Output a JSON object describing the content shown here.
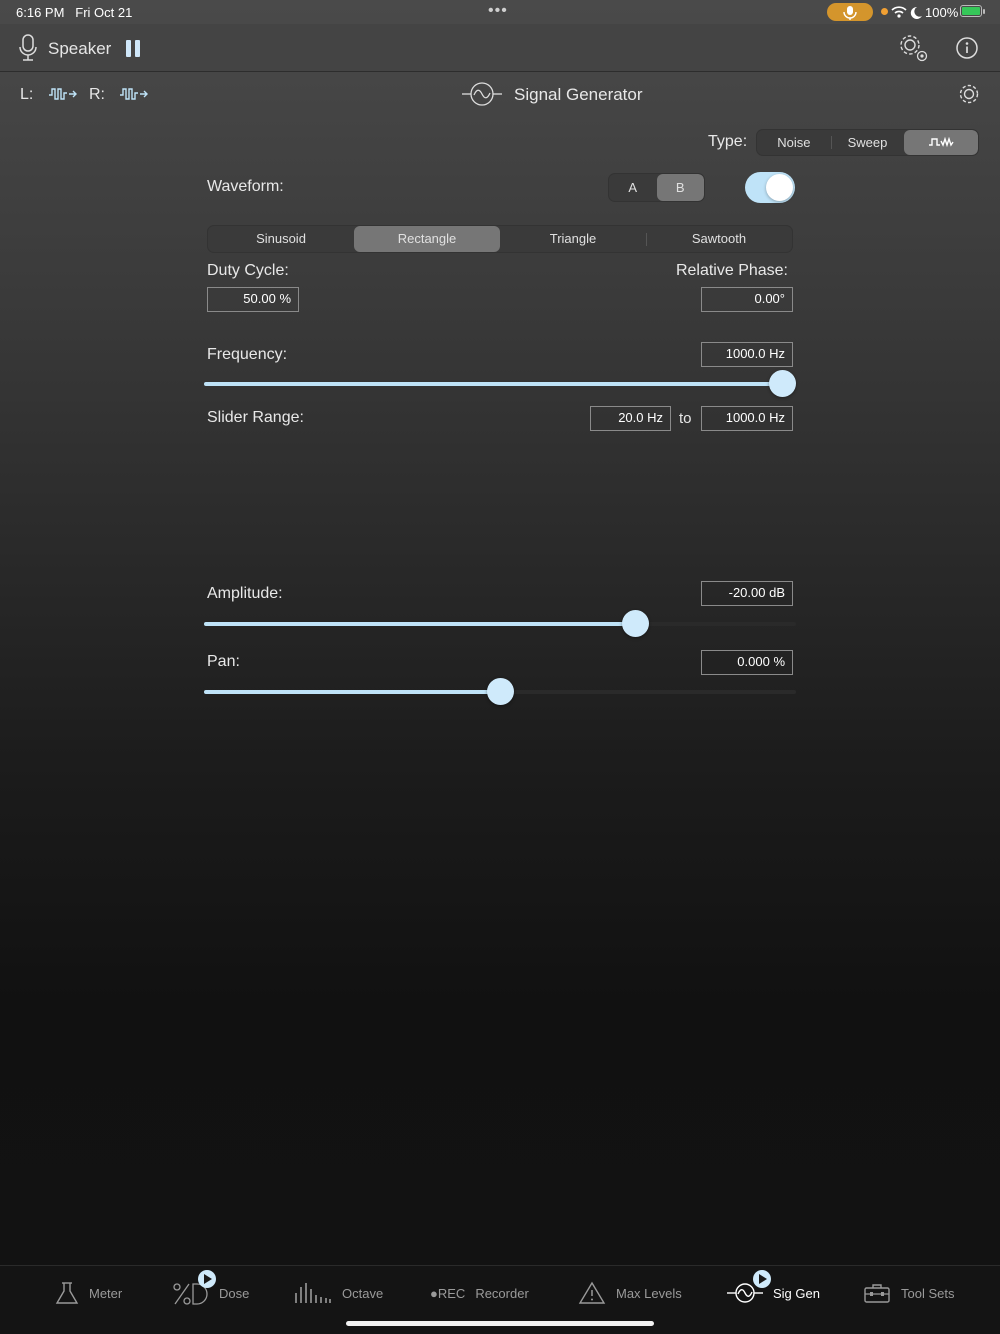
{
  "status_bar": {
    "time": "6:16 PM",
    "date": "Fri Oct 21",
    "battery": "100%",
    "colors": {
      "mic_pill": "#d4952c",
      "battery_fill": "#36c759"
    }
  },
  "toolbar": {
    "input_label": "Speaker"
  },
  "sub_header": {
    "left_channel": "L:",
    "right_channel": "R:",
    "title": "Signal Generator"
  },
  "type_selector": {
    "label": "Type:",
    "options": [
      "Noise",
      "Sweep",
      "waveform"
    ],
    "selected": 2
  },
  "waveform": {
    "label": "Waveform:",
    "ab_options": [
      "A",
      "B"
    ],
    "ab_selected": 1,
    "enabled": true,
    "shapes": [
      "Sinusoid",
      "Rectangle",
      "Triangle",
      "Sawtooth"
    ],
    "shape_selected": 1
  },
  "duty_cycle": {
    "label": "Duty Cycle:",
    "value": "50.00 %"
  },
  "relative_phase": {
    "label": "Relative Phase:",
    "value": "0.00°"
  },
  "frequency": {
    "label": "Frequency:",
    "value": "1000.0 Hz",
    "slider_fraction": 1.0
  },
  "slider_range": {
    "label": "Slider Range:",
    "min": "20.0 Hz",
    "to_label": "to",
    "max": "1000.0 Hz"
  },
  "amplitude": {
    "label": "Amplitude:",
    "value": "-20.00 dB",
    "slider_fraction": 0.74
  },
  "pan": {
    "label": "Pan:",
    "value": "0.000 %",
    "slider_fraction": 0.5
  },
  "tabs": [
    {
      "label": "Meter",
      "icon": "flask-icon"
    },
    {
      "label": "Dose",
      "icon": "percent-dose-icon"
    },
    {
      "label": "Octave",
      "icon": "bars-icon"
    },
    {
      "label": "Recorder",
      "icon": "rec-icon",
      "prefix": "●REC"
    },
    {
      "label": "Max Levels",
      "icon": "warning-icon"
    },
    {
      "label": "Sig Gen",
      "icon": "sine-wave-icon",
      "active": true
    },
    {
      "label": "Tool Sets",
      "icon": "toolbox-icon"
    }
  ],
  "accent_color": "#bfe3f8"
}
